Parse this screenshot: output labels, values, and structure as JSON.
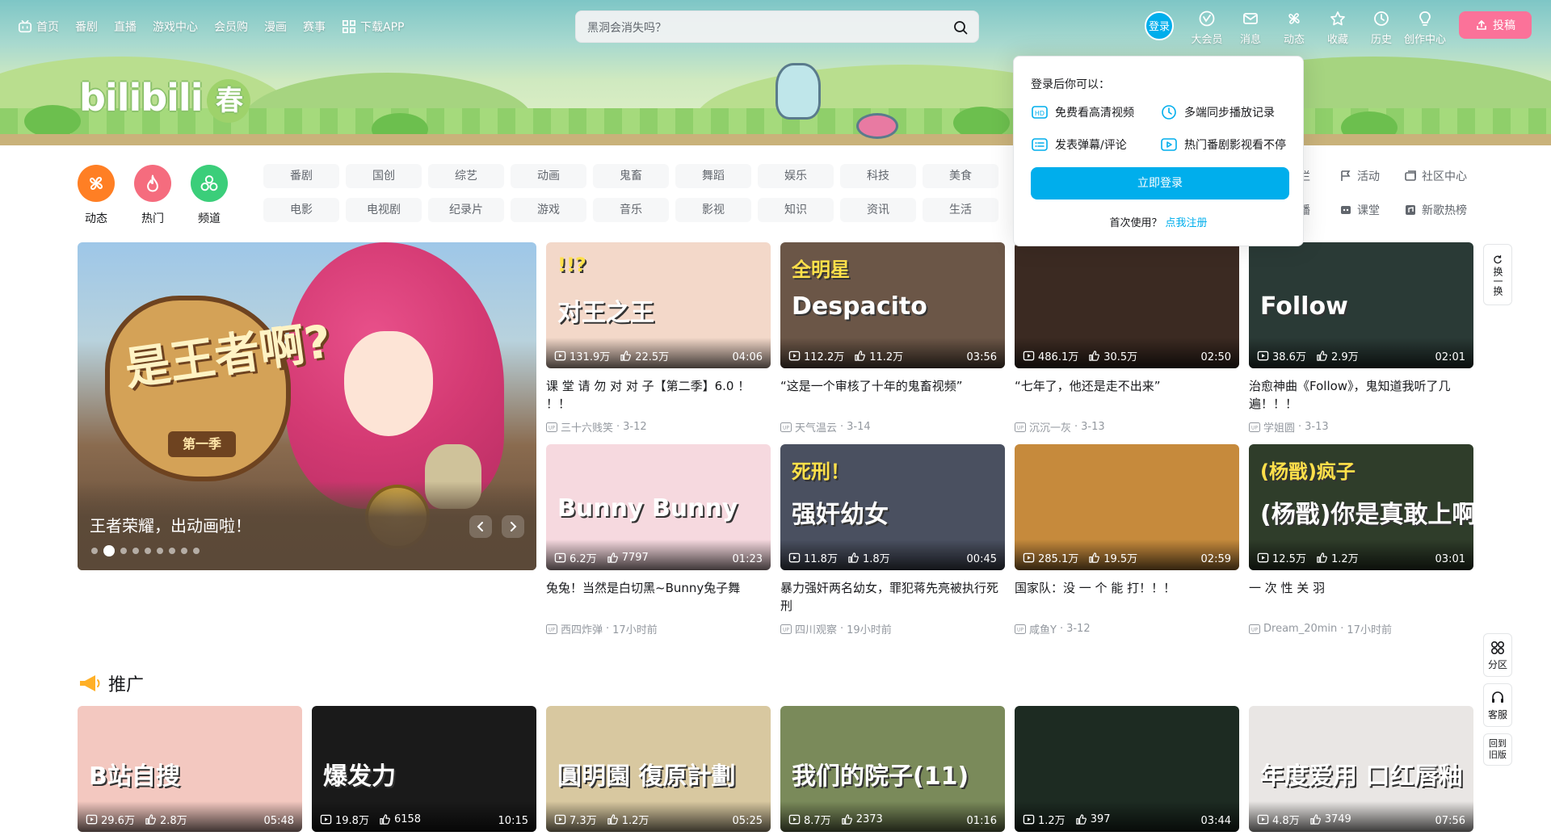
{
  "topnav": {
    "items": [
      "首页",
      "番剧",
      "直播",
      "游戏中心",
      "会员购",
      "漫画",
      "赛事",
      "下载APP"
    ]
  },
  "search": {
    "placeholder": "黑洞会消失吗？"
  },
  "user": {
    "login": "登录",
    "items": [
      "大会员",
      "消息",
      "动态",
      "收藏",
      "历史",
      "创作中心"
    ],
    "upload": "投稿"
  },
  "popover": {
    "title": "登录后你可以：",
    "features": [
      "免费看高清视频",
      "多端同步播放记录",
      "发表弹幕/评论",
      "热门番剧影视看不停"
    ],
    "login_button": "立即登录",
    "first_use": "首次使用？",
    "register_link": "点我注册"
  },
  "channels": [
    "动态",
    "热门",
    "频道"
  ],
  "tags": [
    "番剧",
    "国创",
    "综艺",
    "动画",
    "鬼畜",
    "舞蹈",
    "娱乐",
    "科技",
    "美食",
    "电影",
    "电视剧",
    "纪录片",
    "游戏",
    "音乐",
    "影视",
    "知识",
    "资讯",
    "生活"
  ],
  "side_links": [
    "专栏",
    "活动",
    "社区中心",
    "直播",
    "课堂",
    "新歌热榜"
  ],
  "carousel": {
    "title": "王者荣耀，出动画啦！",
    "art_text": "是王者啊?",
    "season": "第一季",
    "dot_count": 9,
    "active_dot": 1
  },
  "videos": [
    {
      "views": "131.9万",
      "likes": "22.5万",
      "duration": "04:06",
      "title": "课 堂 请 勿 对 对 子【第二季】6.0 ！ ！！",
      "author": "三十六贱笑",
      "date": "3-12",
      "thumb_text": "对王之王",
      "thumb_text2": "!!?",
      "bg": "#f3d8c9"
    },
    {
      "views": "112.2万",
      "likes": "11.2万",
      "duration": "03:56",
      "title": "“这是一个审核了十年的鬼畜视频”",
      "author": "天气温云",
      "date": "3-14",
      "thumb_text": "Despacito",
      "thumb_text2": "全明星",
      "bg": "#6b5647"
    },
    {
      "views": "486.1万",
      "likes": "30.5万",
      "duration": "02:50",
      "title": "“七年了，他还是走不出来”",
      "author": "沉沉一灰",
      "date": "3-13",
      "thumb_text": "",
      "thumb_text2": "",
      "bg": "#3b2a22"
    },
    {
      "views": "38.6万",
      "likes": "2.9万",
      "duration": "02:01",
      "title": "治愈神曲《Follow》，鬼知道我听了几遍！！！",
      "author": "学姐圆",
      "date": "3-13",
      "thumb_text": "Follow",
      "thumb_text2": "",
      "bg": "#2a3a36"
    },
    {
      "views": "6.2万",
      "likes": "7797",
      "duration": "01:23",
      "title": "兔兔！当然是白切黑~Bunny兔子舞",
      "author": "西四炸弹",
      "date": "17小时前",
      "thumb_text": "Bunny Bunny",
      "thumb_text2": "",
      "bg": "#f6d9df"
    },
    {
      "views": "11.8万",
      "likes": "1.8万",
      "duration": "00:45",
      "title": "暴力强奸两名幼女，罪犯蒋先亮被执行死刑",
      "author": "四川观察",
      "date": "19小时前",
      "thumb_text": "强奸幼女",
      "thumb_text2": "死刑！",
      "bg": "#4a5060"
    },
    {
      "views": "285.1万",
      "likes": "19.5万",
      "duration": "02:59",
      "title": "国家队：没 一 个 能 打！！！",
      "author": "咸鱼Y",
      "date": "3-12",
      "thumb_text": "",
      "thumb_text2": "",
      "bg": "#c68a3c"
    },
    {
      "views": "12.5万",
      "likes": "1.2万",
      "duration": "03:01",
      "title": "一 次 性 关 羽",
      "author": "Dream_20min",
      "date": "17小时前",
      "thumb_text": "(杨戬)你是真敢上啊",
      "thumb_text2": "(杨戬)疯子",
      "bg": "#2f3d2a"
    }
  ],
  "promo": {
    "title": "推广",
    "items": [
      {
        "views": "29.6万",
        "likes": "2.8万",
        "duration": "05:48",
        "thumb_text": "B站自搜",
        "bg": "#f3c8c0"
      },
      {
        "views": "19.8万",
        "likes": "6158",
        "duration": "10:15",
        "thumb_text": "爆发力",
        "bg": "#1a1a1a"
      },
      {
        "views": "7.3万",
        "likes": "1.2万",
        "duration": "05:25",
        "thumb_text": "圓明園 復原計劃",
        "bg": "#d8c8a0"
      },
      {
        "views": "8.7万",
        "likes": "2373",
        "duration": "01:16",
        "thumb_text": "我们的院子(11)",
        "bg": "#7a8a5a"
      },
      {
        "views": "1.2万",
        "likes": "397",
        "duration": "03:44",
        "thumb_text": "",
        "bg": "#1d2b22"
      },
      {
        "views": "4.8万",
        "likes": "3749",
        "duration": "07:56",
        "thumb_text": "年度爱用 口红唇釉",
        "bg": "#e9e6e4"
      }
    ]
  },
  "side_tools": {
    "refresh": "换一换",
    "zone": "分区",
    "service": "客服",
    "old": "回到旧版"
  },
  "colors": {
    "brand_blue": "#00aeec",
    "brand_pink": "#fb7299",
    "orange": "#ff7f24",
    "pink": "#f56c7e",
    "green": "#3bce7a"
  }
}
